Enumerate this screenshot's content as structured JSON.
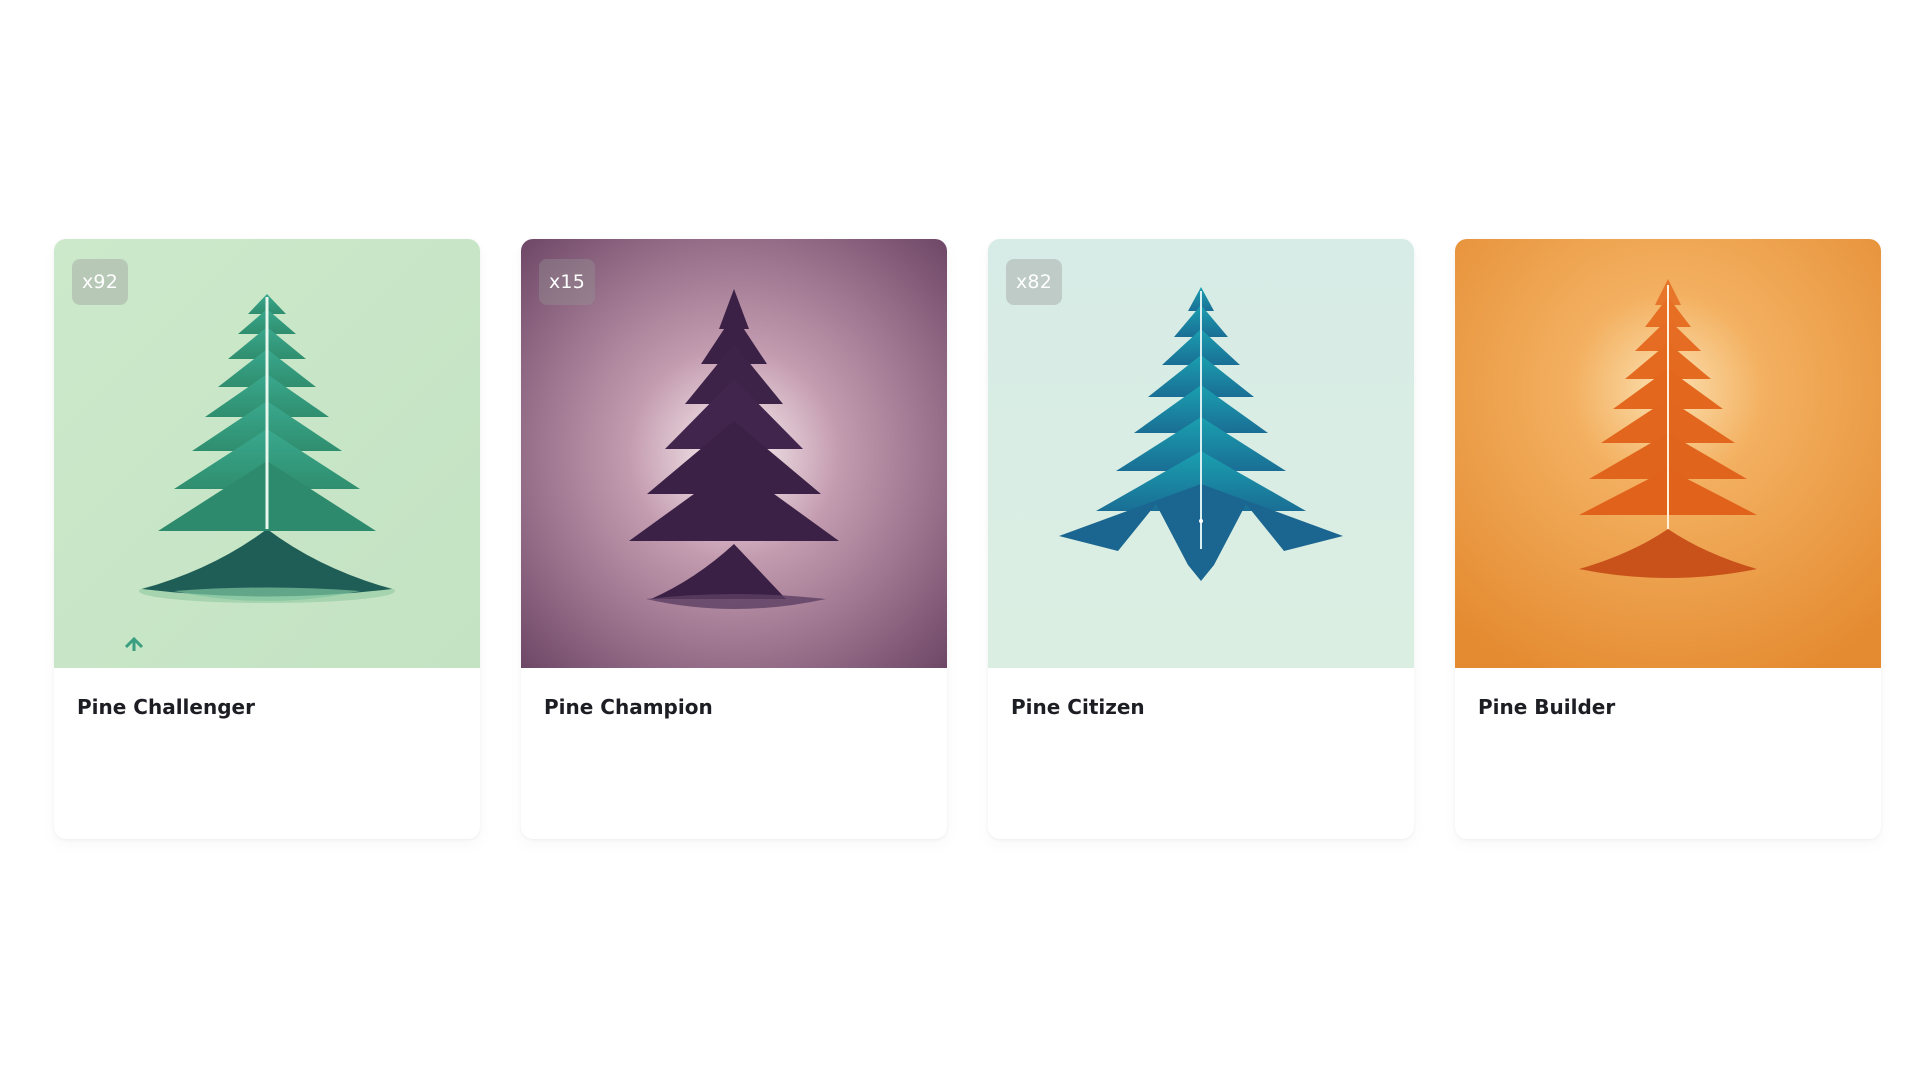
{
  "cards": [
    {
      "title": "Pine Challenger",
      "badge": "x92",
      "icon": "green-pine-tree-icon",
      "colors": {
        "background": "#c9e7c6",
        "tree": "#3a9f80",
        "tree_dark": "#1f5e57"
      }
    },
    {
      "title": "Pine Champion",
      "badge": "x15",
      "icon": "purple-pine-tree-icon",
      "colors": {
        "background": "#8a5d7a",
        "tree": "#3b2146",
        "glow": "#fff6f6"
      }
    },
    {
      "title": "Pine Citizen",
      "badge": "x82",
      "icon": "blue-pine-tree-icon",
      "colors": {
        "background": "#d8ece4",
        "tree": "#1e7fa0",
        "tree_dark": "#18557a"
      }
    },
    {
      "title": "Pine Builder",
      "badge": "",
      "icon": "orange-pine-tree-icon",
      "colors": {
        "background": "#e9973f",
        "tree": "#e06a1e",
        "glow": "#fbe0b0"
      }
    }
  ]
}
